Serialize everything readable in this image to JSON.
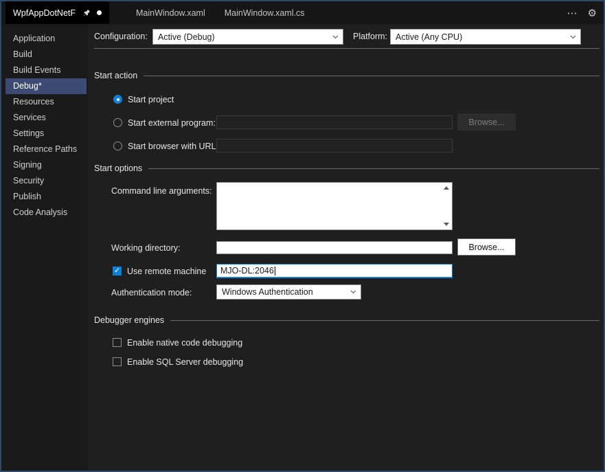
{
  "colors": {
    "accent_blue": "#0F80D7",
    "sidebar_selection": "#3D4A73",
    "focus_border": "#0F80D7"
  },
  "tabbar": {
    "tabs": [
      {
        "label": "WpfAppDotNetF",
        "active": true,
        "pinned": true,
        "modified": true
      },
      {
        "label": "MainWindow.xaml",
        "active": false
      },
      {
        "label": "MainWindow.xaml.cs",
        "active": false
      }
    ],
    "overflow_icon": "⋯",
    "gear_icon": "⚙"
  },
  "sidebar": {
    "items": [
      {
        "label": "Application",
        "selected": false
      },
      {
        "label": "Build",
        "selected": false
      },
      {
        "label": "Build Events",
        "selected": false
      },
      {
        "label": "Debug*",
        "selected": true
      },
      {
        "label": "Resources",
        "selected": false
      },
      {
        "label": "Services",
        "selected": false
      },
      {
        "label": "Settings",
        "selected": false
      },
      {
        "label": "Reference Paths",
        "selected": false
      },
      {
        "label": "Signing",
        "selected": false
      },
      {
        "label": "Security",
        "selected": false
      },
      {
        "label": "Publish",
        "selected": false
      },
      {
        "label": "Code Analysis",
        "selected": false
      }
    ]
  },
  "main": {
    "configuration": {
      "label": "Configuration:",
      "value": "Active (Debug)"
    },
    "platform": {
      "label": "Platform:",
      "value": "Active (Any CPU)"
    },
    "start_action": {
      "title": "Start action",
      "start_project": {
        "label": "Start project",
        "selected": true
      },
      "start_external": {
        "label": "Start external program:",
        "selected": false,
        "value": "",
        "browse_label": "Browse...",
        "enabled": false
      },
      "start_browser": {
        "label": "Start browser with URL:",
        "selected": false,
        "value": "",
        "enabled": false
      }
    },
    "start_options": {
      "title": "Start options",
      "command_line": {
        "label": "Command line arguments:",
        "value": ""
      },
      "working_directory": {
        "label": "Working directory:",
        "value": "",
        "browse_label": "Browse..."
      },
      "remote_machine": {
        "label": "Use remote machine",
        "checked": true,
        "value": "MJO-DL:2046"
      },
      "authentication": {
        "label": "Authentication mode:",
        "value": "Windows Authentication"
      }
    },
    "debugger_engines": {
      "title": "Debugger engines",
      "native": {
        "label": "Enable native code debugging",
        "checked": false
      },
      "sql": {
        "label": "Enable SQL Server debugging",
        "checked": false
      }
    }
  }
}
